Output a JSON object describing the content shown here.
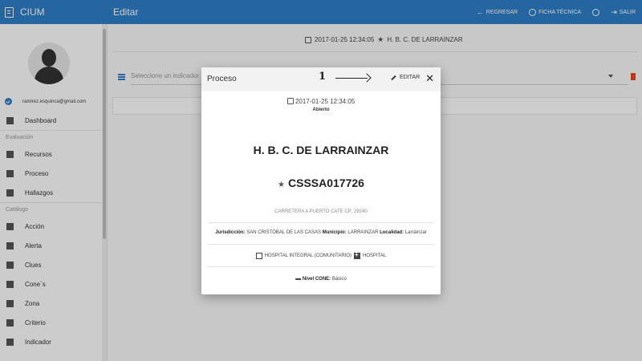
{
  "app": {
    "name": "CIUM",
    "page_title": "Editar"
  },
  "top_actions": {
    "back": "REGRESAR",
    "sheet": "FICHA TÉCNICA",
    "exit": "SALIR"
  },
  "sidebar": {
    "email": "ramirez.esquinca@gmail.com",
    "dashboard": "Dashboard",
    "section_eval": "Evaluación",
    "eval_items": [
      "Recursos",
      "Proceso",
      "Hallazgos"
    ],
    "section_catalog": "Catálogo",
    "catalog_items": [
      "Acción",
      "Alerta",
      "Clues",
      "Cone´s",
      "Zona",
      "Criterio",
      "Indicador"
    ]
  },
  "main": {
    "datetime": "2017-01-25 12:34:05",
    "unit": "H. B. C. DE LARRAINZAR",
    "select_placeholder": "Seleccione un indicador"
  },
  "modal": {
    "title": "Proceso",
    "annotation_number": "1",
    "edit_label": "EDITAR",
    "close_symbol": "✕",
    "datetime": "2017-01-25 12:34:05",
    "status": "Abierto",
    "unit_name": "H. B. C. DE LARRAINZAR",
    "clues": "CSSSA017726",
    "address": "CARRETERA A PUERTO CATE CP: 29240",
    "jurisdiccion_label": "Jurisdicción:",
    "jurisdiccion_value": "SAN CRISTÓBAL DE LAS CASAS",
    "municipio_label": "Municipio:",
    "municipio_value": "LARRAINZAR",
    "localidad_label": "Localidad:",
    "localidad_value": "Larráinzar",
    "type": "HOSPITAL INTEGRAL (COMUNITARIO)",
    "category": "HOSPITAL",
    "cone_label": "Nivel CONE:",
    "cone_value": "Básico"
  },
  "colors": {
    "primary": "#2f80c8",
    "danger": "#e64a19"
  }
}
